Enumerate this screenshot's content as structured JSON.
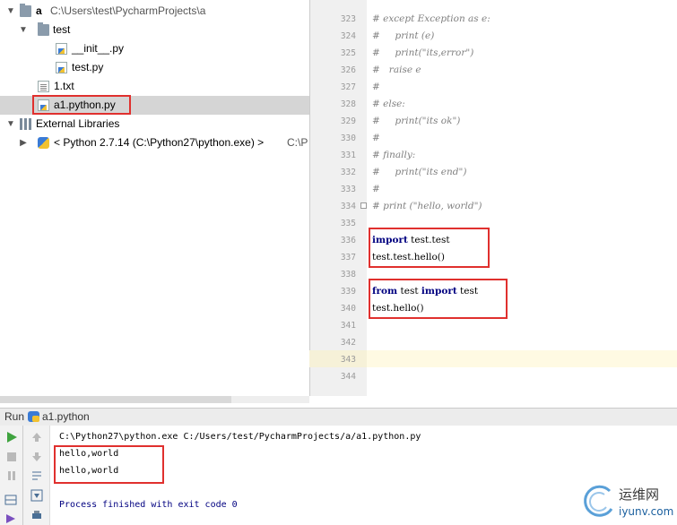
{
  "project_tree": {
    "root": {
      "name": "a",
      "path": "C:\\Users\\test\\PycharmProjects\\a"
    },
    "items": [
      {
        "label": "test"
      },
      {
        "label": "__init__.py"
      },
      {
        "label": "test.py"
      },
      {
        "label": "1.txt"
      },
      {
        "label": "a1.python.py"
      },
      {
        "label": "External Libraries"
      },
      {
        "label": "< Python 2.7.14 (C:\\Python27\\python.exe) >",
        "path": "C:\\P"
      }
    ]
  },
  "editor": {
    "line_numbers": [
      "323",
      "324",
      "325",
      "326",
      "327",
      "328",
      "329",
      "330",
      "331",
      "332",
      "333",
      "334",
      "335",
      "336",
      "337",
      "338",
      "339",
      "340",
      "341",
      "342",
      "343",
      "344"
    ],
    "lines": {
      "l323": "# except Exception as e:",
      "l324": "#     print (e)",
      "l325": "#     print(\"its,error\")",
      "l326": "#   raise e",
      "l327": "#",
      "l328": "# else:",
      "l329": "#     print(\"its ok\")",
      "l330": "#",
      "l331": "# finally:",
      "l332": "#     print(\"its end\")",
      "l333": "#",
      "l334": "# print (\"hello, world\")",
      "l336_kw": "import",
      "l336_rest": " test.test",
      "l337": "test.test.hello()",
      "l339_kw1": "from",
      "l339_mid": " test ",
      "l339_kw2": "import",
      "l339_rest": " test",
      "l340": "test.hello()"
    }
  },
  "run": {
    "label": "Run",
    "config_name": "a1.python",
    "command": "C:\\Python27\\python.exe C:/Users/test/PycharmProjects/a/a1.python.py",
    "output": [
      "hello,world",
      "hello,world"
    ],
    "exit_message": "Process finished with exit code 0"
  },
  "watermark": {
    "cn": "运维网",
    "en": "iyunv.com"
  },
  "colors": {
    "highlight_box": "#e0302e",
    "keyword": "#000080",
    "comment": "#808080",
    "run_green": "#3fa33f"
  }
}
